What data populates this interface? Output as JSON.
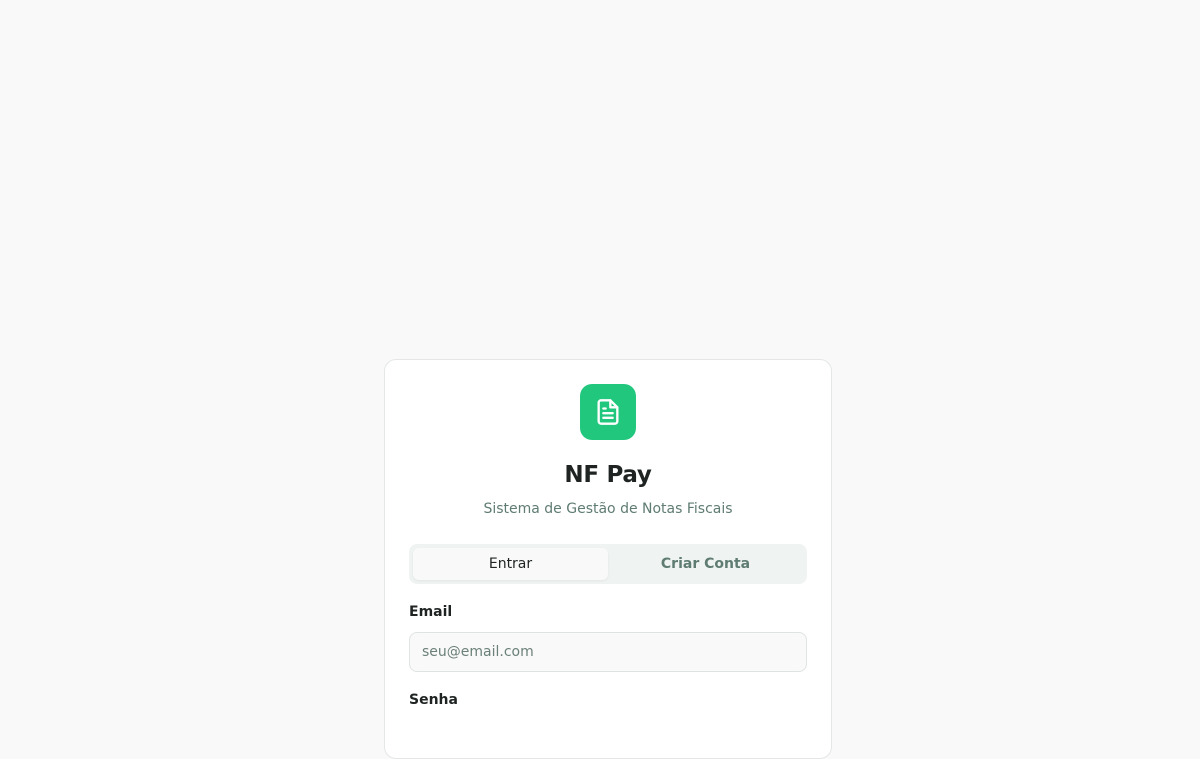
{
  "app": {
    "name": "NF Pay",
    "subtitle": "Sistema de Gestão de Notas Fiscais",
    "logo_icon": "document-icon",
    "accent_color": "#22c77e"
  },
  "tabs": [
    {
      "label": "Entrar",
      "active": true
    },
    {
      "label": "Criar Conta",
      "active": false
    }
  ],
  "form": {
    "email": {
      "label": "Email",
      "placeholder": "seu@email.com",
      "value": ""
    },
    "password": {
      "label": "Senha"
    }
  }
}
